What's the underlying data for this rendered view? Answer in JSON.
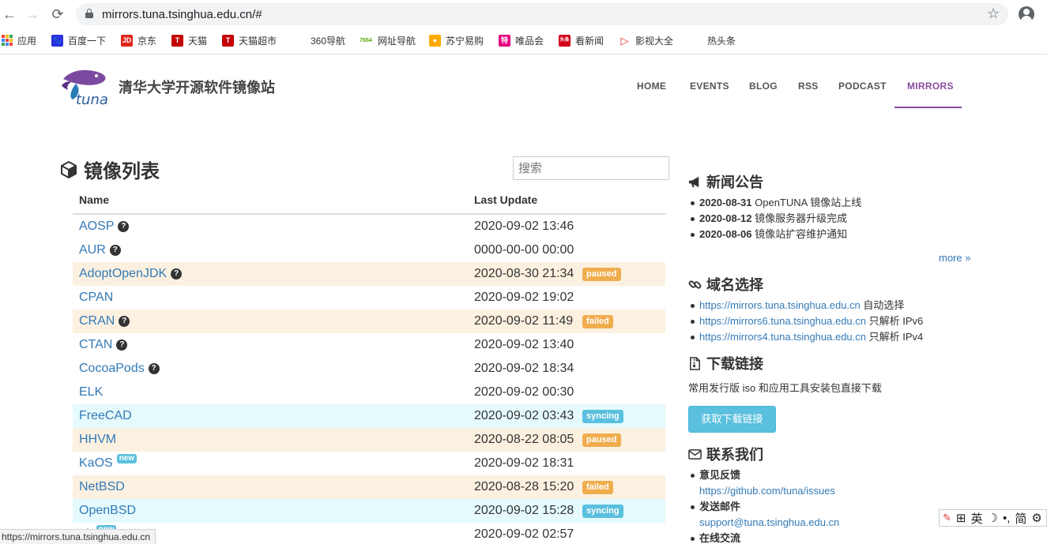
{
  "browser": {
    "url": "mirrors.tuna.tsinghua.edu.cn/#",
    "back_glyph": "←",
    "forward_glyph": "→",
    "reload_glyph": "⟳",
    "star_glyph": "☆",
    "bookmarks": [
      {
        "label": "应用",
        "icon": "apps-grid-icon"
      },
      {
        "label": "百度一下",
        "icon": "baidu-icon"
      },
      {
        "label": "京东",
        "icon": "jd-icon",
        "icon_text": "JD"
      },
      {
        "label": "天猫",
        "icon": "tmall-icon",
        "icon_text": "T"
      },
      {
        "label": "天猫超市",
        "icon": "tmall-market-icon",
        "icon_text": "T"
      },
      {
        "label": "360导航",
        "icon": "360-icon"
      },
      {
        "label": "网址导航",
        "icon": "7654-icon",
        "icon_text": "7654"
      },
      {
        "label": "苏宁易购",
        "icon": "suning-icon"
      },
      {
        "label": "唯品会",
        "icon": "vip-icon",
        "icon_text": "特"
      },
      {
        "label": "看新闻",
        "icon": "news-icon",
        "icon_text": "头条"
      },
      {
        "label": "影视大全",
        "icon": "video-icon"
      },
      {
        "label": "热头条",
        "icon": "hot-news-icon"
      }
    ],
    "status_url": "https://mirrors.tuna.tsinghua.edu.cn"
  },
  "site": {
    "title": "清华大学开源软件镜像站",
    "logo_text": "tuna",
    "nav": [
      "HOME",
      "EVENTS",
      "BLOG",
      "RSS",
      "PODCAST",
      "MIRRORS"
    ],
    "accent": "#8b4c9f"
  },
  "mirrors": {
    "title": "镜像列表",
    "search_placeholder": "搜索",
    "headers": [
      "Name",
      "Last Update"
    ],
    "help_glyph": "?",
    "new_label": "new",
    "rows": [
      {
        "name": "AOSP",
        "date": "2020-09-02 13:46",
        "help": true,
        "status": ""
      },
      {
        "name": "AUR",
        "date": "0000-00-00 00:00",
        "help": true,
        "status": ""
      },
      {
        "name": "AdoptOpenJDK",
        "date": "2020-08-30 21:34",
        "help": true,
        "status": "paused"
      },
      {
        "name": "CPAN",
        "date": "2020-09-02 19:02",
        "help": false,
        "status": ""
      },
      {
        "name": "CRAN",
        "date": "2020-09-02 11:49",
        "help": true,
        "status": "failed"
      },
      {
        "name": "CTAN",
        "date": "2020-09-02 13:40",
        "help": true,
        "status": ""
      },
      {
        "name": "CocoaPods",
        "date": "2020-09-02 18:34",
        "help": true,
        "status": ""
      },
      {
        "name": "ELK",
        "date": "2020-09-02 00:30",
        "help": false,
        "status": ""
      },
      {
        "name": "FreeCAD",
        "date": "2020-09-02 03:43",
        "help": false,
        "status": "syncing"
      },
      {
        "name": "HHVM",
        "date": "2020-08-22 08:05",
        "help": false,
        "status": "paused"
      },
      {
        "name": "KaOS",
        "date": "2020-09-02 18:31",
        "help": false,
        "status": "",
        "new": true
      },
      {
        "name": "NetBSD",
        "date": "2020-08-28 15:20",
        "help": false,
        "status": "failed"
      },
      {
        "name": "OpenBSD",
        "date": "2020-09-02 15:28",
        "help": false,
        "status": "syncing"
      },
      {
        "name": "ult",
        "date": "2020-09-02 02:57",
        "help": false,
        "status": "",
        "new": true
      }
    ]
  },
  "news": {
    "title": "新闻公告",
    "items": [
      {
        "date": "2020-08-31",
        "text": "OpenTUNA 镜像站上线"
      },
      {
        "date": "2020-08-12",
        "text": "镜像服务器升级完成"
      },
      {
        "date": "2020-08-06",
        "text": "镜像站扩容维护通知"
      }
    ],
    "more": "more »"
  },
  "domains": {
    "title": "域名选择",
    "items": [
      {
        "url": "https://mirrors.tuna.tsinghua.edu.cn",
        "note": "自动选择"
      },
      {
        "url": "https://mirrors6.tuna.tsinghua.edu.cn",
        "note": "只解析 IPv6"
      },
      {
        "url": "https://mirrors4.tuna.tsinghua.edu.cn",
        "note": "只解析 IPv4"
      }
    ]
  },
  "downloads": {
    "title": "下载链接",
    "text": "常用发行版 iso 和应用工具安装包直接下载",
    "button": "获取下载链接"
  },
  "contact": {
    "title": "联系我们",
    "feedback_label": "意见反馈",
    "feedback_url": "https://github.com/tuna/issues",
    "mail_label": "发送邮件",
    "mail": "support@tuna.tsinghua.edu.cn",
    "chat_label": "在线交流"
  },
  "ime": {
    "mode": "英",
    "punct": "•,",
    "script": "简"
  }
}
